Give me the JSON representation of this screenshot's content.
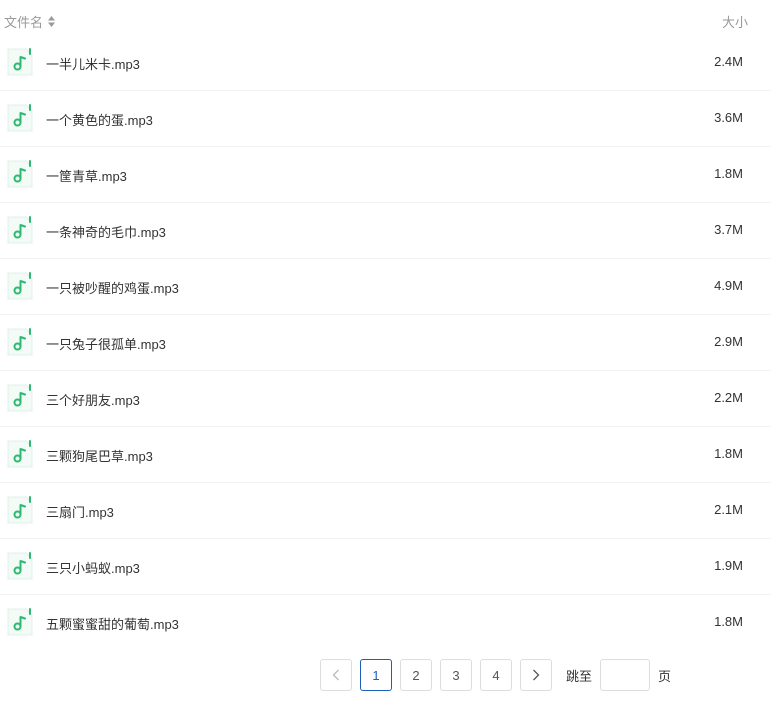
{
  "header": {
    "name_label": "文件名",
    "size_label": "大小"
  },
  "files": [
    {
      "name": "一半儿米卡.mp3",
      "size": "2.4M"
    },
    {
      "name": "一个黄色的蛋.mp3",
      "size": "3.6M"
    },
    {
      "name": "一筐青草.mp3",
      "size": "1.8M"
    },
    {
      "name": "一条神奇的毛巾.mp3",
      "size": "3.7M"
    },
    {
      "name": "一只被吵醒的鸡蛋.mp3",
      "size": "4.9M"
    },
    {
      "name": "一只兔子很孤单.mp3",
      "size": "2.9M"
    },
    {
      "name": "三个好朋友.mp3",
      "size": "2.2M"
    },
    {
      "name": "三颗狗尾巴草.mp3",
      "size": "1.8M"
    },
    {
      "name": "三扇门.mp3",
      "size": "2.1M"
    },
    {
      "name": "三只小蚂蚁.mp3",
      "size": "1.9M"
    },
    {
      "name": "五颗蜜蜜甜的葡萄.mp3",
      "size": "1.8M"
    }
  ],
  "pagination": {
    "prev_icon": "chevron-left-icon",
    "next_icon": "chevron-right-icon",
    "pages": [
      "1",
      "2",
      "3",
      "4"
    ],
    "current": "1",
    "jump_label": "跳至",
    "jump_value": "",
    "page_suffix": "页"
  },
  "colors": {
    "accent": "#1d5fb8",
    "music_icon": "#2eb872",
    "border": "#dddddd"
  }
}
